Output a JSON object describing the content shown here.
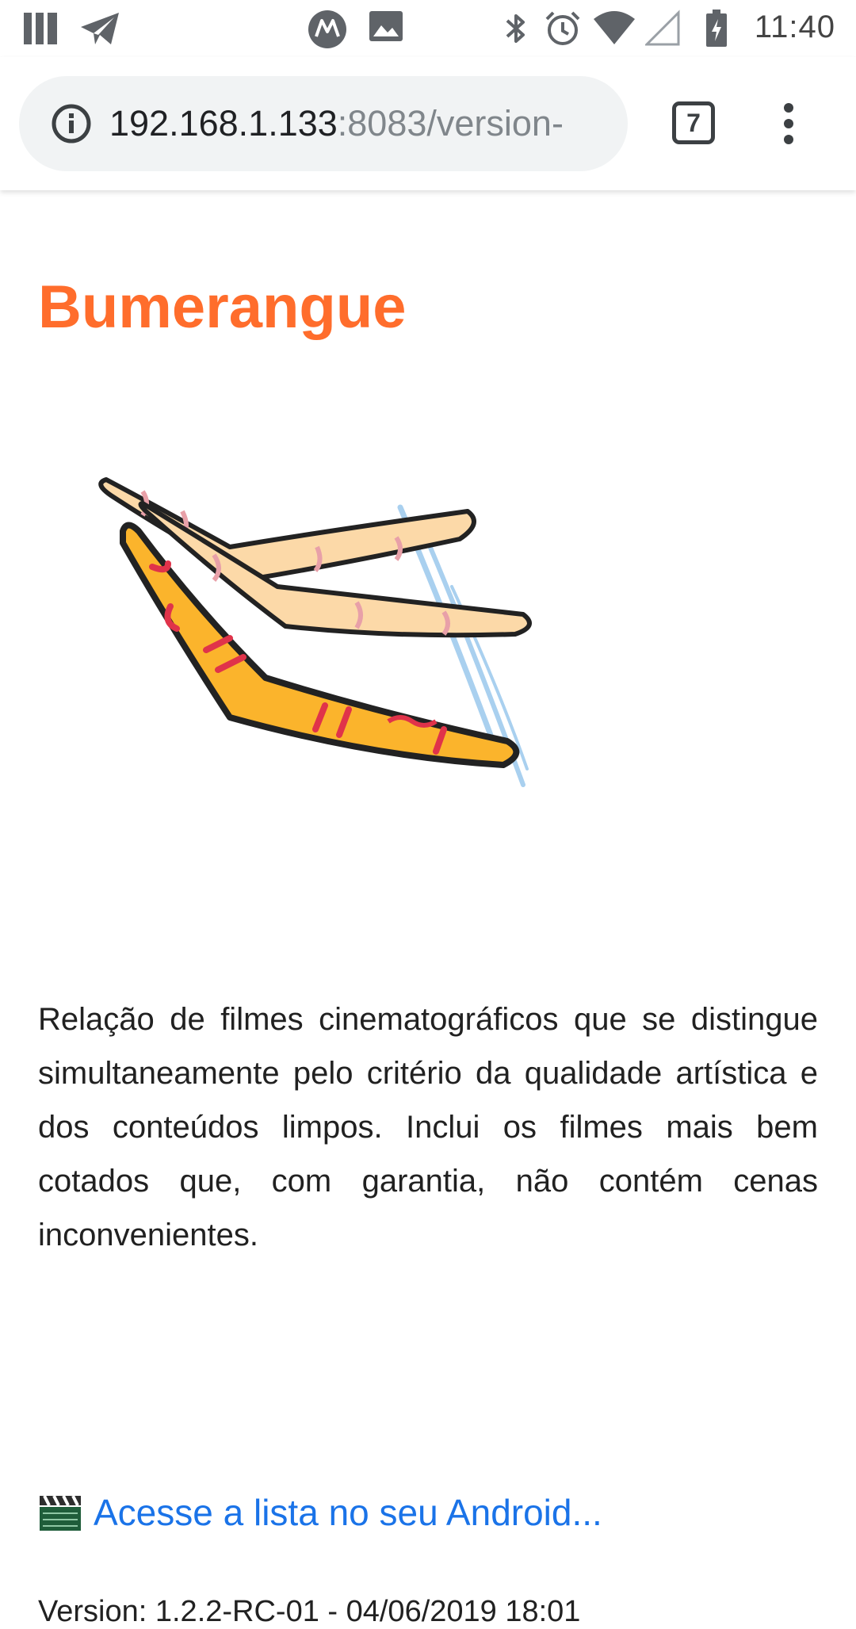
{
  "status_bar": {
    "time": "11:40",
    "left_icons": [
      "app-icon",
      "telegram-icon",
      "motorola-icon",
      "gallery-icon"
    ],
    "right_icons": [
      "bluetooth-icon",
      "alarm-icon",
      "wifi-icon",
      "signal-icon",
      "battery-charging-icon"
    ]
  },
  "toolbar": {
    "url_host": "192.168.1.133",
    "url_rest": ":8083/version-",
    "tab_count": "7"
  },
  "page": {
    "title": "Bumerangue",
    "title_color": "#ff6d2c",
    "description": "Relação de filmes cinematográficos que se distingue simultaneamente pelo critério da qualidade artística e dos conteúdos limpos. Inclui os filmes mais bem cotados que, com garantia, não contém cenas inconvenientes.",
    "link_text": "Acesse a lista no seu Android...",
    "link_color": "#1a73e8",
    "version": "Version: 1.2.2-RC-01 - 04/06/2019 18:01"
  }
}
